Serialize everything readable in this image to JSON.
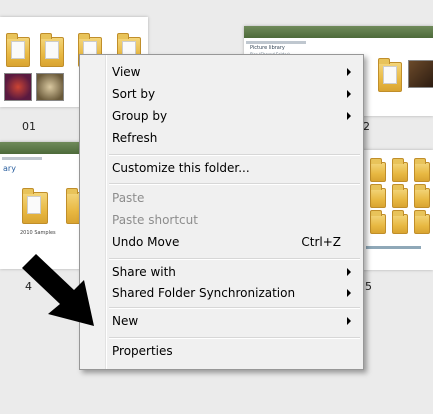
{
  "thumbnails": {
    "top_left_label": "01",
    "top_right_label": "2",
    "bottom_left_label": "4",
    "bottom_right_label": "5",
    "top_right_window_title": "Picture library",
    "top_right_window_subtitle": "Pics (Shared Folder)",
    "bottom_left_window_title": "ary",
    "bottom_left_folder_caption": "2010 Samples"
  },
  "context_menu": {
    "items": [
      {
        "label": "View",
        "submenu": true,
        "disabled": false
      },
      {
        "label": "Sort by",
        "submenu": true,
        "disabled": false
      },
      {
        "label": "Group by",
        "submenu": true,
        "disabled": false
      },
      {
        "label": "Refresh",
        "submenu": false,
        "disabled": false
      },
      {
        "label": "Customize this folder...",
        "submenu": false,
        "disabled": false
      },
      {
        "label": "Paste",
        "submenu": false,
        "disabled": true
      },
      {
        "label": "Paste shortcut",
        "submenu": false,
        "disabled": true
      },
      {
        "label": "Undo Move",
        "submenu": false,
        "disabled": false,
        "shortcut": "Ctrl+Z"
      },
      {
        "label": "Share with",
        "submenu": true,
        "disabled": false
      },
      {
        "label": "Shared Folder Synchronization",
        "submenu": true,
        "disabled": false
      },
      {
        "label": "New",
        "submenu": true,
        "disabled": false
      },
      {
        "label": "Properties",
        "submenu": false,
        "disabled": false
      }
    ]
  },
  "colors": {
    "background": "#ebebeb",
    "menu_background": "#f0f0f0",
    "menu_border": "#979797",
    "disabled_text": "#8d8d8d",
    "folder_yellow": "#e8b842",
    "pointer_arrow": "#000000"
  }
}
